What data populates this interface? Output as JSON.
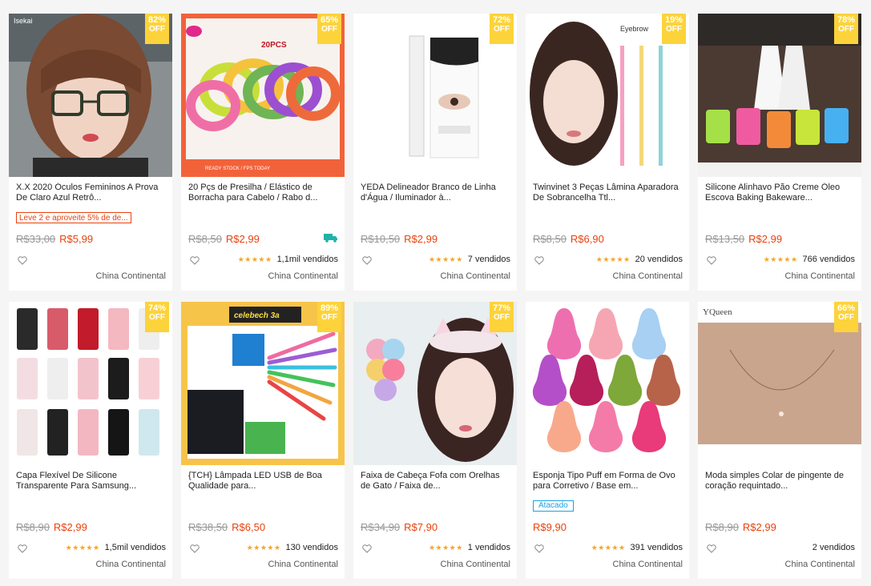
{
  "products": [
    {
      "discount": "82%",
      "off": "OFF",
      "title": "X.X 2020 Óculos Femininos A Prova De Claro Azul Retrô...",
      "promo": "Leve 2 e aproveite 5% de de...",
      "old_price": "R$33,00",
      "price": "R$5,99",
      "stars": "",
      "sold": "",
      "origin": "China Continental",
      "image": "woman-glasses-photo",
      "thumb_label": "Isekai"
    },
    {
      "discount": "65%",
      "off": "OFF",
      "title": "20 Pçs de Presilha / Elástico de Borracha para Cabelo / Rabo d...",
      "old_price": "R$8,50",
      "price": "R$2,99",
      "shipping_icon": "truck-icon",
      "stars": "★★★★★",
      "sold": "1,1mil vendidos",
      "origin": "China Continental",
      "image": "hair-ties-photo",
      "thumb_label": "20PCS",
      "thumb_footer": "READY STOCK / FPS TODAY"
    },
    {
      "discount": "72%",
      "off": "OFF",
      "title": "YEDA Delineador Branco de Linha d'Água / Iluminador à...",
      "old_price": "R$10,50",
      "price": "R$2,99",
      "stars": "★★★★★",
      "sold": "7 vendidos",
      "origin": "China Continental",
      "image": "white-eyeliner-photo"
    },
    {
      "discount": "19%",
      "off": "OFF",
      "title": "Twinvinet 3 Peças Lâmina Aparadora De Sobrancelha Ttl...",
      "old_price": "R$8,50",
      "price": "R$6,90",
      "stars": "★★★★★",
      "sold": "20 vendidos",
      "origin": "China Continental",
      "image": "eyebrow-razor-photo",
      "thumb_label": "Eyebrow"
    },
    {
      "discount": "78%",
      "off": "OFF",
      "title": "Silicone Alinhavo Pão Creme Óleo Escova Baking Bakeware...",
      "old_price": "R$13,50",
      "price": "R$2,99",
      "stars": "★★★★★",
      "sold": "766 vendidos",
      "origin": "China Continental",
      "image": "silicone-brush-photo"
    },
    {
      "discount": "74%",
      "off": "OFF",
      "title": "Capa Flexível De Silicone Transparente Para Samsung...",
      "old_price": "R$8,90",
      "price": "R$2,99",
      "stars": "★★★★★",
      "sold": "1,5mil vendidos",
      "origin": "China Continental",
      "image": "phone-cases-photo"
    },
    {
      "discount": "89%",
      "off": "OFF",
      "title": "{TCH} Lâmpada LED USB de Boa Qualidade para...",
      "old_price": "R$38,50",
      "price": "R$6,50",
      "stars": "★★★★★",
      "sold": "130 vendidos",
      "origin": "China Continental",
      "image": "usb-led-lamp-photo",
      "thumb_label": "celebech 3a"
    },
    {
      "discount": "77%",
      "off": "OFF",
      "title": "Faixa de Cabeça Fofa com Orelhas de Gato / Faixa de...",
      "old_price": "R$34,90",
      "price": "R$7,90",
      "stars": "★★★★★",
      "sold": "1 vendidos",
      "origin": "China Continental",
      "image": "cat-ear-headband-photo"
    },
    {
      "discount": "",
      "off": "",
      "title": "Esponja Tipo Puff em Forma de Ovo para Corretivo / Base em...",
      "wholesale": "Atacado",
      "old_price": "",
      "price": "R$9,90",
      "stars": "★★★★★",
      "sold": "391 vendidos",
      "origin": "China Continental",
      "image": "makeup-sponges-photo"
    },
    {
      "discount": "66%",
      "off": "OFF",
      "title": "Moda simples Colar de pingente de coração requintado...",
      "old_price": "R$8,90",
      "price": "R$2,99",
      "stars": "",
      "sold": "2 vendidos",
      "origin": "China Continental",
      "image": "heart-necklace-photo",
      "thumb_label": "YQueen"
    }
  ],
  "colors": {
    "badge": "#fcd33b",
    "price": "#e8420e",
    "stars": "#f5a623",
    "wholesale": "#1ba1e2"
  }
}
